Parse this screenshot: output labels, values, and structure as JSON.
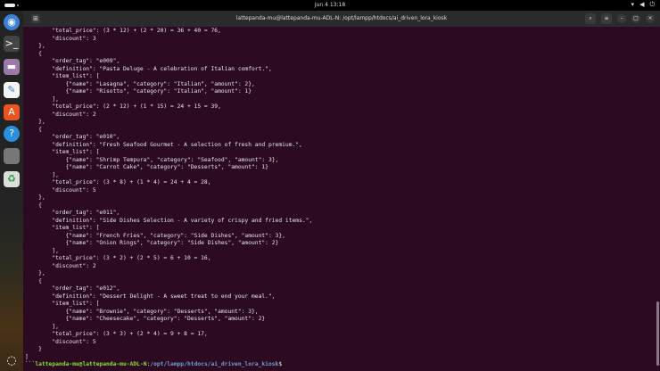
{
  "topbar": {
    "clock": "Jun 4  13:18",
    "tray": [
      "wifi-icon",
      "volume-icon",
      "power-icon"
    ]
  },
  "window": {
    "title": "lattepanda-mu@lattepanda-mu-ADL-N: /opt/lampp/htdocs/ai_driven_lora_kiosk"
  },
  "terminal": {
    "lines": [
      "        \"total_price\": (3 * 12) + (2 * 20) = 36 + 40 = 76,",
      "        \"discount\": 3",
      "    },",
      "    {",
      "        \"order_tag\": \"e009\",",
      "        \"definition\": \"Pasta Deluge - A celebration of Italian comfort.\",",
      "        \"item_list\": [",
      "            {\"name\": \"Lasagna\", \"category\": \"Italian\", \"amount\": 2},",
      "            {\"name\": \"Risotto\", \"category\": \"Italian\", \"amount\": 1}",
      "        ],",
      "        \"total_price\": (2 * 12) + (1 * 15) = 24 + 15 = 39,",
      "        \"discount\": 2",
      "    },",
      "    {",
      "        \"order_tag\": \"e010\",",
      "        \"definition\": \"Fresh Seafood Gourmet - A selection of fresh and premium.\",",
      "        \"item_list\": [",
      "            {\"name\": \"Shrimp Tempura\", \"category\": \"Seafood\", \"amount\": 3},",
      "            {\"name\": \"Carrot Cake\", \"category\": \"Desserts\", \"amount\": 1}",
      "        ],",
      "        \"total_price\": (3 * 8) + (1 * 4) = 24 + 4 = 28,",
      "        \"discount\": 5",
      "    },",
      "    {",
      "        \"order_tag\": \"e011\",",
      "        \"definition\": \"Side Dishes Selection - A variety of crispy and fried items.\",",
      "        \"item_list\": [",
      "            {\"name\": \"French Fries\", \"category\": \"Side Dishes\", \"amount\": 3},",
      "            {\"name\": \"Onion Rings\", \"category\": \"Side Dishes\", \"amount\": 2}",
      "        ],",
      "        \"total_price\": (3 * 2) + (2 * 5) = 6 + 10 = 16,",
      "        \"discount\": 2",
      "    },",
      "    {",
      "        \"order_tag\": \"e012\",",
      "        \"definition\": \"Dessert Delight - A sweet treat to end your meal.\",",
      "        \"item_list\": [",
      "            {\"name\": \"Brownie\", \"category\": \"Desserts\", \"amount\": 3},",
      "            {\"name\": \"Cheesecake\", \"category\": \"Desserts\", \"amount\": 2}",
      "        ],",
      "        \"total_price\": (3 * 3) + (2 * 4) = 9 + 8 = 17,",
      "        \"discount\": 5",
      "    }",
      "]"
    ],
    "prompt": {
      "prefix": "```",
      "user_host": "lattepanda-mu@lattepanda-mu-ADL-N",
      "sep": ":",
      "path": "/opt/lampp/htdocs/ai_driven_lora_kiosk",
      "symbol": "$"
    }
  }
}
